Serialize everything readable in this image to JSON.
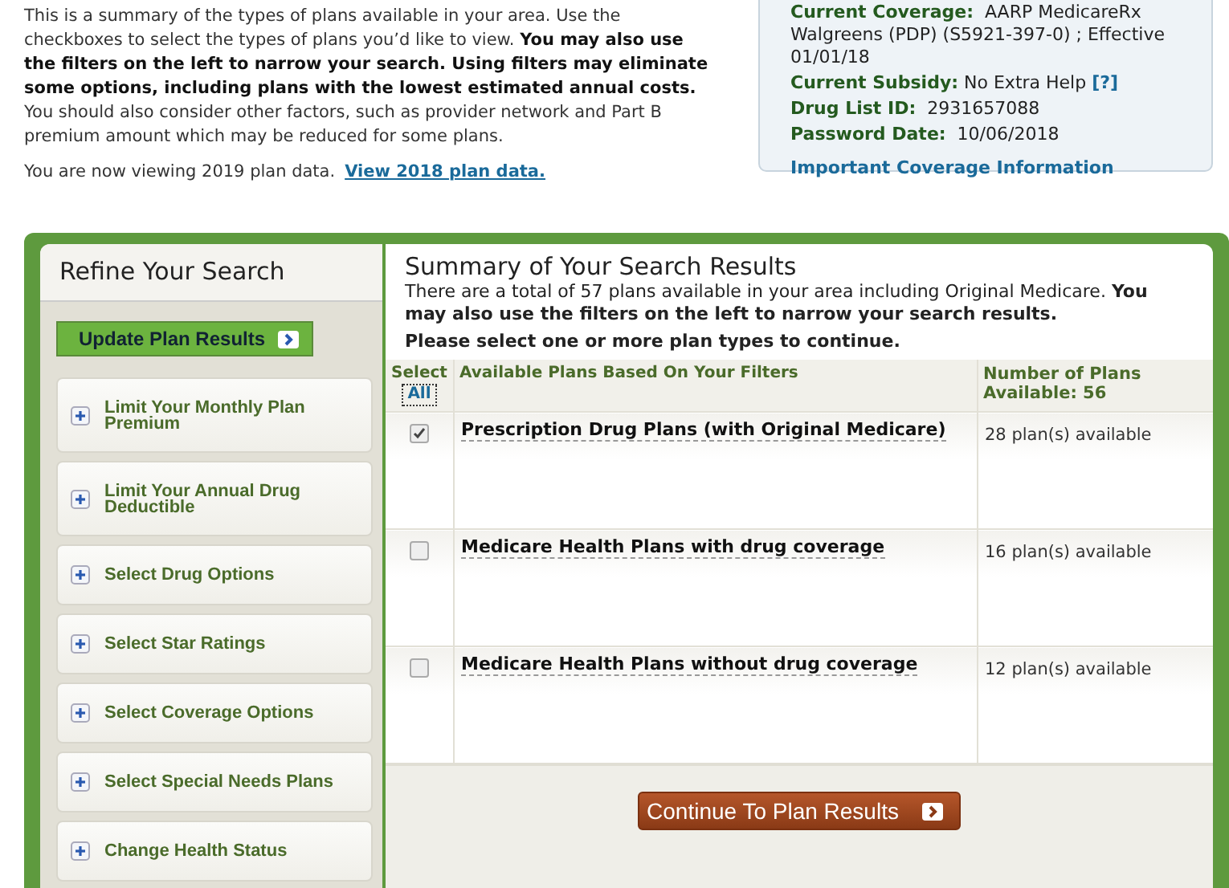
{
  "intro": {
    "paragraph": "This is a summary of the types of plans available in your area. Use the checkboxes to select the types of plans you’d like to view. **You may also use the filters on the left to narrow your search. Using filters may eliminate some options, including plans with the lowest estimated annual costs.** You should also consider other factors, such as provider network and Part B premium amount which may be reduced for some plans.",
    "viewing": "You are now viewing 2019 plan data.",
    "link": "View 2018 plan data."
  },
  "coverage_box": {
    "fields": [
      {
        "text": "**Current Coverage:**  AARP MedicareRx Walgreens (PDP) (S5921-397-0) ; Effective 01/01/18"
      },
      {
        "text": "**Current Subsidy:** No Extra Help",
        "help": "[?]"
      },
      {
        "text": "**Drug List ID:**  2931657088"
      },
      {
        "text": "**Password Date:**  10/06/2018"
      }
    ],
    "link": "Important Coverage Information"
  },
  "refine": {
    "title": "Refine Your Search",
    "update_button": "Update Plan Results",
    "filters": [
      {
        "label": "Limit Your Monthly Plan Premium",
        "expanded": false
      },
      {
        "label": "Limit Your Annual Drug Deductible",
        "expanded": false
      },
      {
        "label": "Select Drug Options",
        "expanded": false
      },
      {
        "label": "Select Star Ratings",
        "expanded": false
      },
      {
        "label": "Select Coverage Options",
        "expanded": false
      },
      {
        "label": "Select Special Needs Plans",
        "expanded": false
      },
      {
        "label": "Change Health Status",
        "expanded": false
      }
    ]
  },
  "summary": {
    "title": "Summary of Your Search Results",
    "description": "There are a total of 57 plans available in your area including Original Medicare. **You may also use the filters on the left to narrow your search results.**",
    "instruction": "Please select one or more plan types to continue.",
    "columns": {
      "select": "Select",
      "select_all": "All",
      "plans": "Available Plans Based On Your Filters",
      "count": "Number of Plans Available:  56"
    },
    "rows": [
      {
        "plan": "Prescription Drug Plans (with Original Medicare)",
        "count": "28 plan(s) available",
        "checked": true
      },
      {
        "plan": "Medicare Health Plans with drug coverage",
        "count": "16 plan(s) available",
        "checked": false
      },
      {
        "plan": "Medicare Health Plans without drug coverage",
        "count": "12 plan(s) available",
        "checked": false
      }
    ],
    "continue_button": "Continue To Plan Results"
  }
}
